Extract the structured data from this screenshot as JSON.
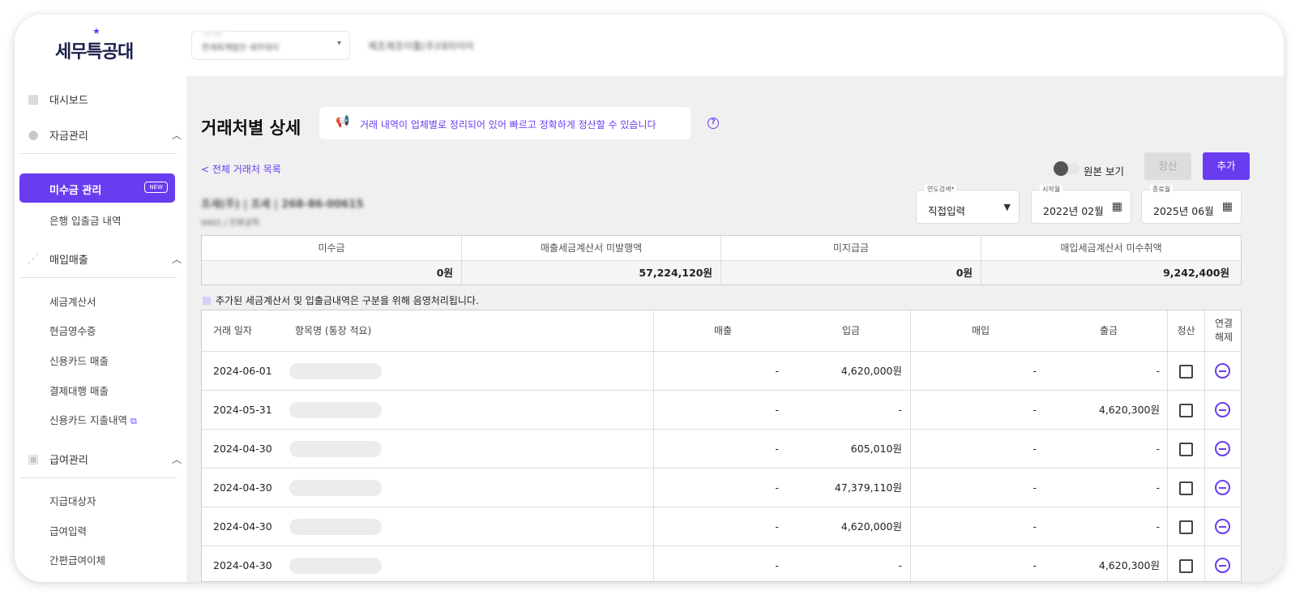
{
  "brand": {
    "logo_text": "세무특공대",
    "logo_star": "★"
  },
  "topbar": {
    "business_label": "나의 상호",
    "business_name": "한세회계법인 세무대리",
    "business_info": "제조제조이틀(주)대리이이"
  },
  "sidebar": {
    "items": [
      {
        "label": "대시보드",
        "icon": "dashboard-icon"
      },
      {
        "label": "자금관리",
        "icon": "piggy-bank-icon",
        "caret": "^"
      },
      {
        "label": "미수금 관리",
        "badge": "NEW",
        "active": true
      },
      {
        "label": "은행 입출금 내역"
      },
      {
        "label": "매입매출",
        "icon": "sparkle-chart-icon",
        "caret": "^"
      },
      {
        "label": "세금계산서"
      },
      {
        "label": "현금영수증"
      },
      {
        "label": "신용카드 매출"
      },
      {
        "label": "결제대행 매출"
      },
      {
        "label": "신용카드 지출내역",
        "icon": "link-icon"
      },
      {
        "label": "급여관리",
        "icon": "wallet-icon",
        "caret": "^"
      },
      {
        "label": "지급대상자"
      },
      {
        "label": "급여입력"
      },
      {
        "label": "간편급여이체"
      }
    ]
  },
  "page": {
    "title": "거래처별 상세",
    "banner": "거래 내역이 업체별로 정리되어 있어 빠르고 정확하게 정산할 수 있습니다",
    "help": "?",
    "back_link": "< 전체 거래처 목록",
    "toggle_label": "원본 보기",
    "settle_button": "정산",
    "add_button": "추가",
    "vendor_name": "조세(주) | 조세 | 268-86-00615",
    "vendor_sub": "0001 | 인화공학"
  },
  "filters": {
    "year": {
      "label": "연도검색*",
      "value": "직접입력"
    },
    "start": {
      "label": "시작월",
      "value": "2022년 02월"
    },
    "end": {
      "label": "종료월",
      "value": "2025년 06월"
    }
  },
  "summary": {
    "headers": [
      "미수금",
      "매출세금계산서 미발행액",
      "미지급금",
      "매입세금계산서 미수취액"
    ],
    "values": [
      "0원",
      "57,224,120원",
      "0원",
      "9,242,400원"
    ]
  },
  "note": "추가된 세금계산서 및 입출금내역은 구분을 위해 음영처리됩니다.",
  "table": {
    "headers": {
      "date": "거래 일자",
      "item": "항목명 (통장 적요)",
      "sales": "매출",
      "deposit": "입금",
      "purchase": "매입",
      "withdraw": "출금",
      "settle": "정산",
      "unlink1": "연결",
      "unlink2": "해제"
    },
    "rows": [
      {
        "date": "2024-06-01",
        "sales": "-",
        "deposit": "4,620,000원",
        "purchase": "-",
        "withdraw": "-"
      },
      {
        "date": "2024-05-31",
        "sales": "-",
        "deposit": "-",
        "purchase": "-",
        "withdraw": "4,620,300원"
      },
      {
        "date": "2024-04-30",
        "sales": "-",
        "deposit": "605,010원",
        "purchase": "-",
        "withdraw": "-"
      },
      {
        "date": "2024-04-30",
        "sales": "-",
        "deposit": "47,379,110원",
        "purchase": "-",
        "withdraw": "-"
      },
      {
        "date": "2024-04-30",
        "sales": "-",
        "deposit": "4,620,000원",
        "purchase": "-",
        "withdraw": "-"
      },
      {
        "date": "2024-04-30",
        "sales": "-",
        "deposit": "-",
        "purchase": "-",
        "withdraw": "4,620,300원"
      }
    ]
  },
  "colors": {
    "accent": "#6a3cf0",
    "background": "#f0f0f0"
  }
}
